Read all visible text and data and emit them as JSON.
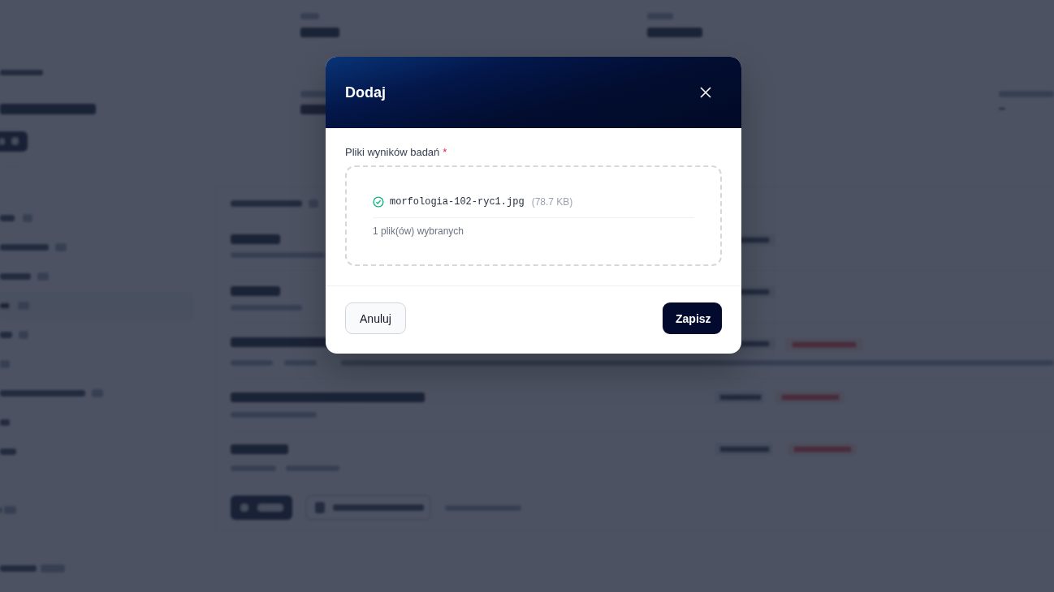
{
  "backdrop": {
    "dimmed": true,
    "blurred": true
  },
  "modal": {
    "title": "Dodaj",
    "field": {
      "label": "Pliki wyników badań",
      "required_mark": "*",
      "files": [
        {
          "name": "morfologia-102-ryc1.jpg",
          "size": "(78.7 KB)",
          "uploaded": true
        }
      ],
      "summary": "1 plik(ów) wybranych"
    },
    "buttons": [
      {
        "label": "Anuluj",
        "kind": "secondary"
      },
      {
        "label": "Zapisz",
        "kind": "primary"
      }
    ]
  }
}
